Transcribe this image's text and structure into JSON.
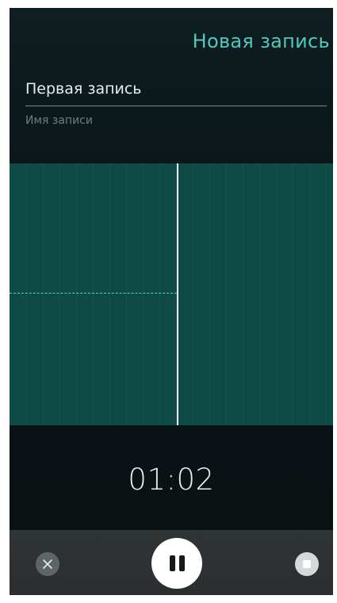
{
  "header": {
    "title": "Новая запись"
  },
  "recording_name": {
    "value": "Первая запись",
    "label": "Имя записи"
  },
  "timer": {
    "elapsed": "01:02"
  },
  "toolbar": {
    "discard_icon": "close-x-icon",
    "pause_icon": "pause-icon",
    "stop_icon": "stop-icon"
  },
  "colors": {
    "accent": "#52c8bd",
    "waveform_background": "#0f4b46",
    "background": "#0b1619"
  }
}
